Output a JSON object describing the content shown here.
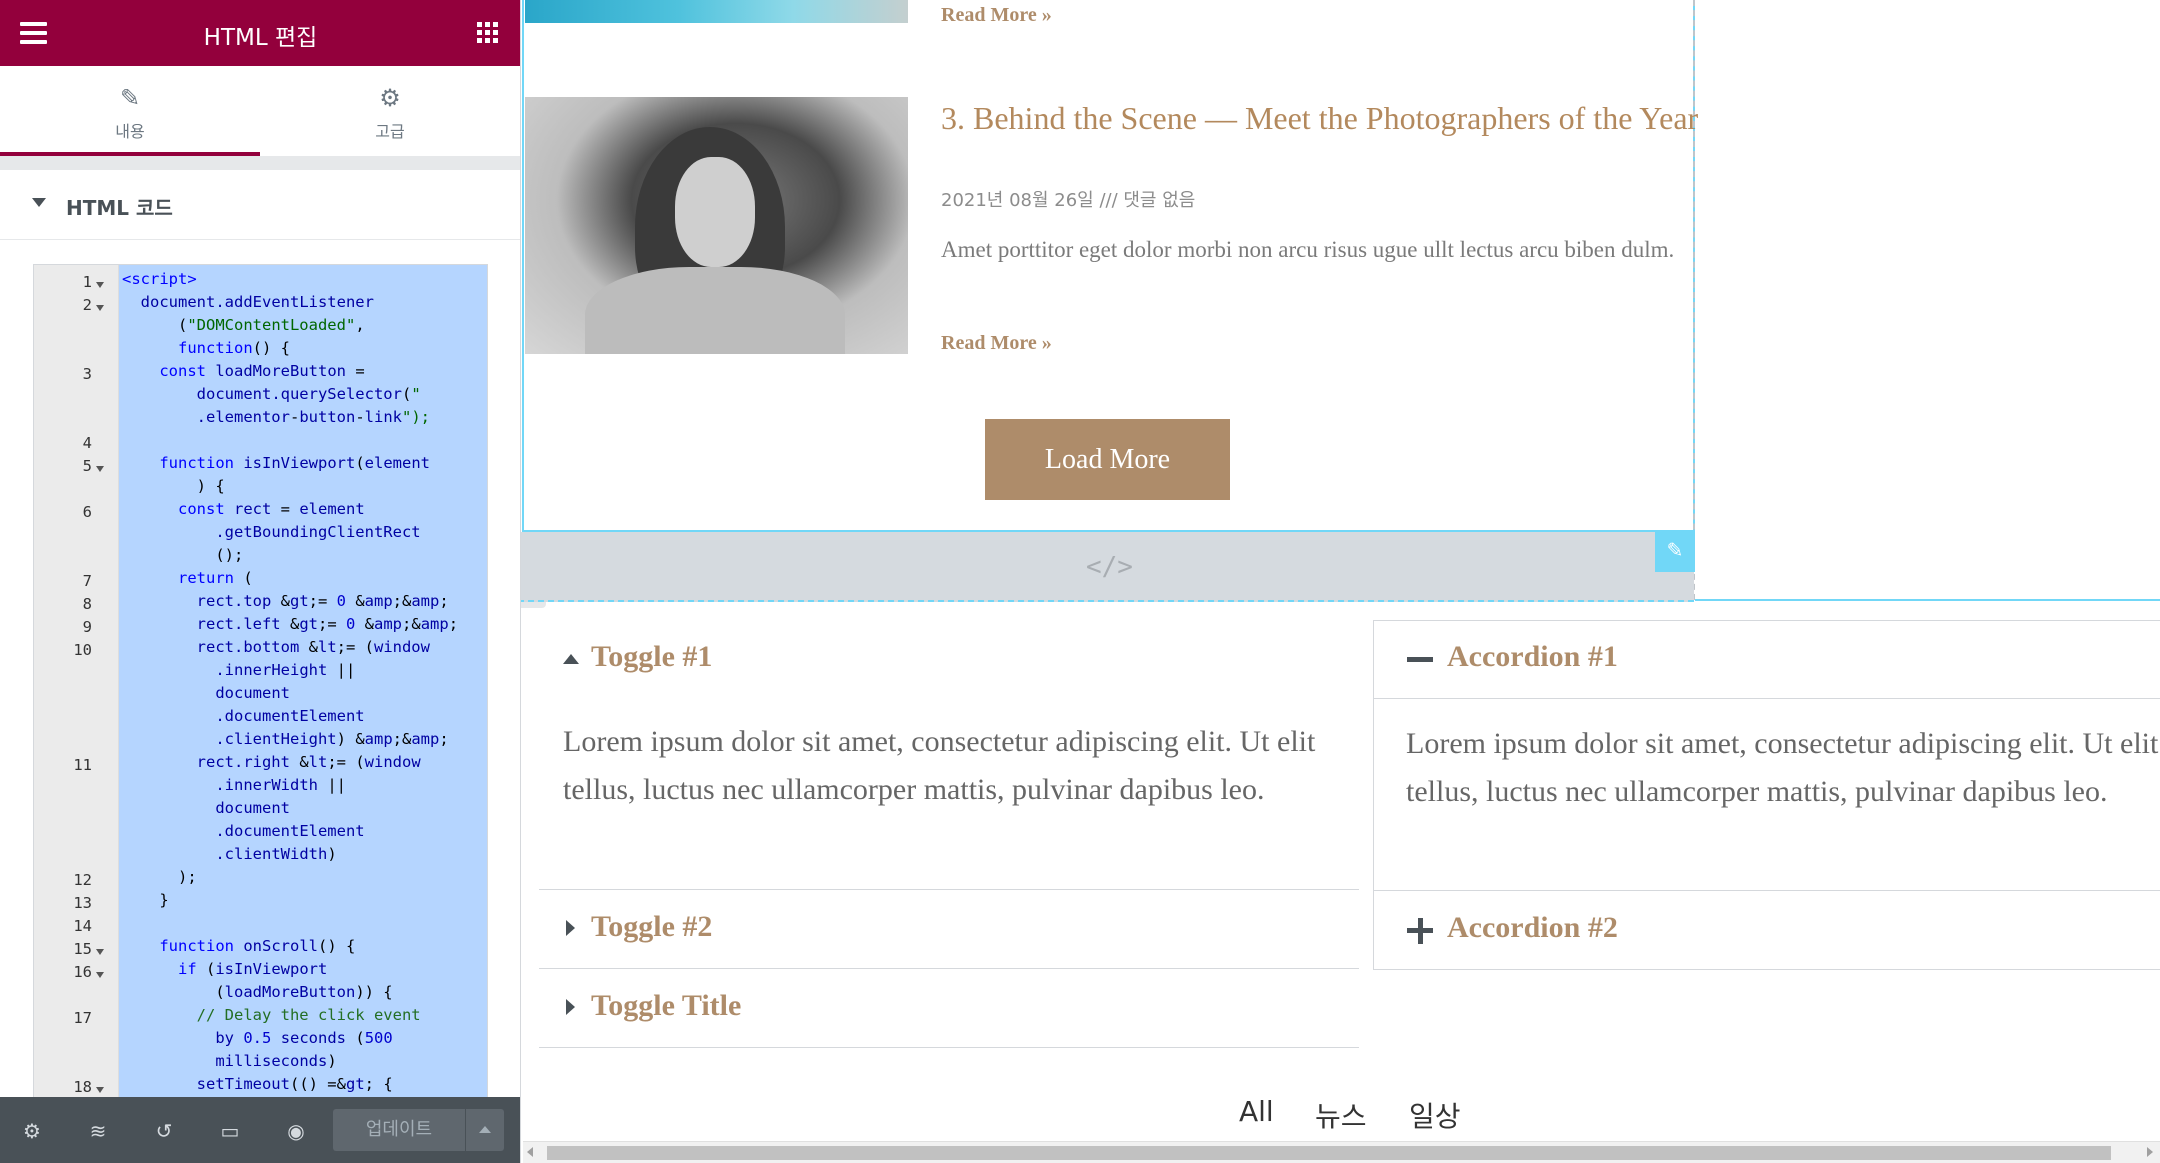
{
  "panel": {
    "title": "HTML 편집",
    "tabs": [
      {
        "label": "내용",
        "icon": "pencil-icon",
        "active": true
      },
      {
        "label": "고급",
        "icon": "gear-icon",
        "active": false
      }
    ],
    "section_title": "HTML 코드",
    "accent_color": "#93003c"
  },
  "code_editor": {
    "lines": [
      {
        "n": "1",
        "fold": true,
        "rows": [
          "<script>"
        ]
      },
      {
        "n": "2",
        "fold": true,
        "rows": [
          "  document.addEventListener",
          "      (\"DOMContentLoaded\",",
          "      function() {"
        ]
      },
      {
        "n": "3",
        "fold": false,
        "rows": [
          "    const loadMoreButton =",
          "        document.querySelector(\"",
          "        .elementor-button-link\");"
        ]
      },
      {
        "n": "4",
        "fold": false,
        "rows": [
          ""
        ]
      },
      {
        "n": "5",
        "fold": true,
        "rows": [
          "    function isInViewport(element",
          "        ) {"
        ]
      },
      {
        "n": "6",
        "fold": false,
        "rows": [
          "      const rect = element",
          "          .getBoundingClientRect",
          "          ();"
        ]
      },
      {
        "n": "7",
        "fold": false,
        "rows": [
          "      return ("
        ]
      },
      {
        "n": "8",
        "fold": false,
        "rows": [
          "        rect.top >= 0 &&"
        ]
      },
      {
        "n": "9",
        "fold": false,
        "rows": [
          "        rect.left >= 0 &&"
        ]
      },
      {
        "n": "10",
        "fold": false,
        "rows": [
          "        rect.bottom <= (window",
          "          .innerHeight ||",
          "          document",
          "          .documentElement",
          "          .clientHeight) &&"
        ]
      },
      {
        "n": "11",
        "fold": false,
        "rows": [
          "        rect.right <= (window",
          "          .innerWidth ||",
          "          document",
          "          .documentElement",
          "          .clientWidth)"
        ]
      },
      {
        "n": "12",
        "fold": false,
        "rows": [
          "      );"
        ]
      },
      {
        "n": "13",
        "fold": false,
        "rows": [
          "    }"
        ]
      },
      {
        "n": "14",
        "fold": false,
        "rows": [
          ""
        ]
      },
      {
        "n": "15",
        "fold": true,
        "rows": [
          "    function onScroll() {"
        ]
      },
      {
        "n": "16",
        "fold": true,
        "rows": [
          "      if (isInViewport",
          "          (loadMoreButton)) {"
        ]
      },
      {
        "n": "17",
        "fold": false,
        "rows": [
          "        // Delay the click event",
          "          by 0.5 seconds (500",
          "          milliseconds)"
        ]
      },
      {
        "n": "18",
        "fold": true,
        "rows": [
          "        setTimeout(() => {"
        ]
      }
    ]
  },
  "bottom_bar": {
    "icons": [
      "settings-icon",
      "layers-icon",
      "history-icon",
      "responsive-icon",
      "preview-eye-icon"
    ],
    "update_label": "업데이트"
  },
  "preview": {
    "read_more": "Read More »",
    "post": {
      "title": "3. Behind the Scene — Meet the Photographers of the Year",
      "meta": "2021년 08월 26일 /// 댓글 없음",
      "excerpt": "Amet porttitor eget dolor morbi non arcu risus ugue ullt lectus arcu biben dulm.",
      "read_more": "Read More »"
    },
    "load_more": "Load More",
    "toggle": {
      "items": [
        {
          "title": "Toggle #1",
          "open": true,
          "body": "Lorem ipsum dolor sit amet, consectetur adipiscing elit. Ut elit tellus, luctus nec ullamcorper mattis, pulvinar dapibus leo."
        },
        {
          "title": "Toggle #2",
          "open": false
        },
        {
          "title": "Toggle Title",
          "open": false
        }
      ]
    },
    "accordion": {
      "items": [
        {
          "title": "Accordion #1",
          "open": true,
          "body": "Lorem ipsum dolor sit amet, consectetur adipiscing elit. Ut elit tellus, luctus nec ullamcorper mattis, pulvinar dapibus leo."
        },
        {
          "title": "Accordion #2",
          "open": false
        }
      ]
    },
    "filters": [
      "All",
      "뉴스",
      "일상"
    ],
    "brand_color": "#ae8c6a",
    "selection_color": "#71d7f7"
  }
}
